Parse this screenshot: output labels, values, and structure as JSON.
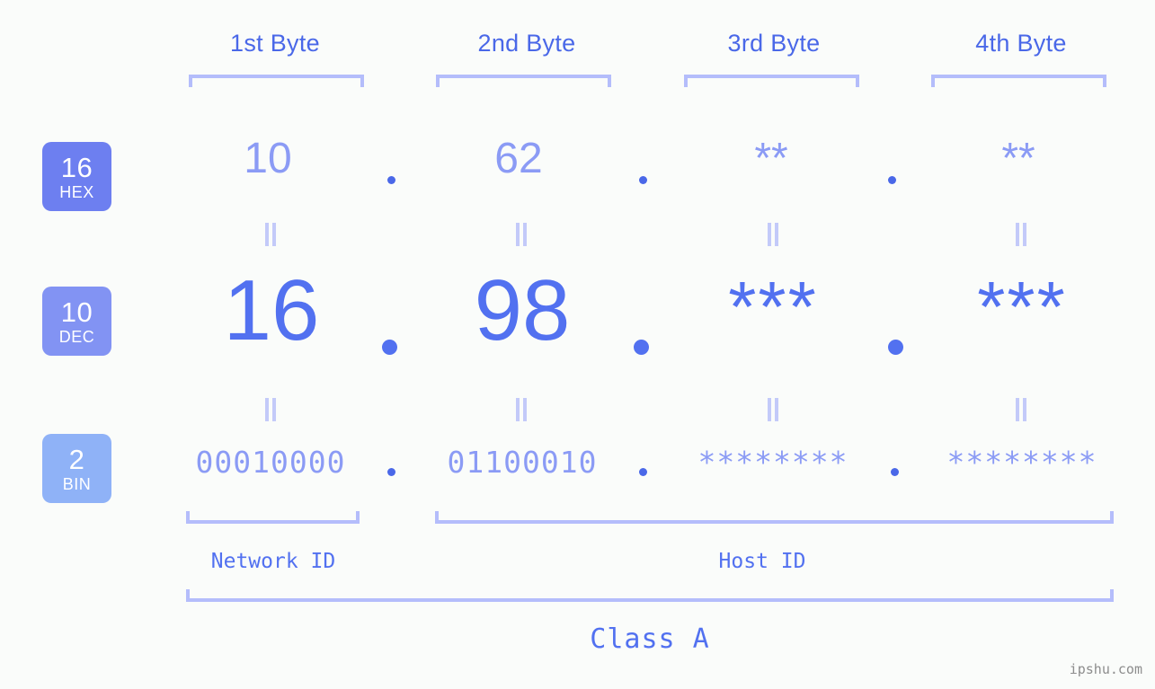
{
  "diagram": {
    "byte_headers": [
      {
        "label": "1st Byte"
      },
      {
        "label": "2nd Byte"
      },
      {
        "label": "3rd Byte"
      },
      {
        "label": "4th Byte"
      }
    ],
    "rows": [
      {
        "badge_number": "16",
        "badge_base": "HEX",
        "values": [
          "10",
          "62",
          "**",
          "**"
        ],
        "separator": "."
      },
      {
        "badge_number": "10",
        "badge_base": "DEC",
        "values": [
          "16",
          "98",
          "***",
          "***"
        ],
        "separator": "."
      },
      {
        "badge_number": "2",
        "badge_base": "BIN",
        "values": [
          "00010000",
          "01100010",
          "********",
          "********"
        ],
        "separator": "."
      }
    ],
    "equivalence_symbol": "=",
    "network_id_label": "Network ID",
    "host_id_label": "Host ID",
    "class_label": "Class A",
    "watermark": "ipshu.com",
    "colors": {
      "background": "#fafcfa",
      "accent_strong": "#5271f0",
      "accent_mid": "#8b9bf5",
      "accent_light": "#b4bdfb",
      "badge_hex": "#6d7ff0",
      "badge_dec": "#8293f3",
      "badge_bin": "#8fb2f7",
      "watermark": "#8d8d8d"
    }
  }
}
